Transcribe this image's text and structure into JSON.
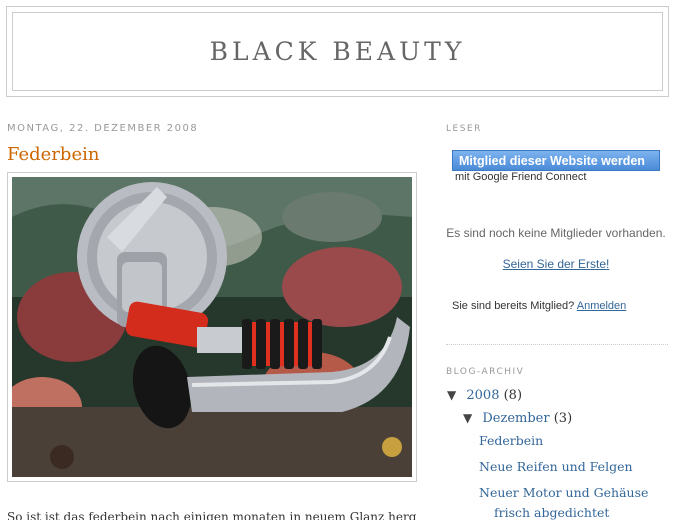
{
  "blog": {
    "title": "BLACK BEAUTY"
  },
  "post": {
    "date": "MONTAG, 22. DEZEMBER 2008",
    "title": "Federbein",
    "body_partial": "So ist ist das federbein nach einigen monaten in neuem Glanz hergestellt"
  },
  "sidebar": {
    "followers": {
      "heading": "LESER",
      "join_button": "Mitglied dieser Website werden",
      "via": "mit Google Friend Connect",
      "no_members": "Es sind noch keine Mitglieder vorhanden.",
      "be_first": "Seien Sie der Erste!",
      "already_member": "Sie sind bereits Mitglied?",
      "sign_in": "Anmelden"
    },
    "archive": {
      "heading": "BLOG-ARCHIV",
      "year": {
        "label": "2008",
        "count": "(8)",
        "toggle": "▼"
      },
      "month": {
        "label": "Dezember",
        "count": "(3)",
        "toggle": "▼"
      },
      "posts": [
        "Federbein",
        "Neue Reifen und Felgen",
        "Neuer Motor und Gehäuse",
        "frisch abgedichtet"
      ]
    }
  },
  "colors": {
    "post_title": "#cc6600",
    "link": "#336699",
    "muted": "#999999",
    "button": "#4a8ad8"
  }
}
